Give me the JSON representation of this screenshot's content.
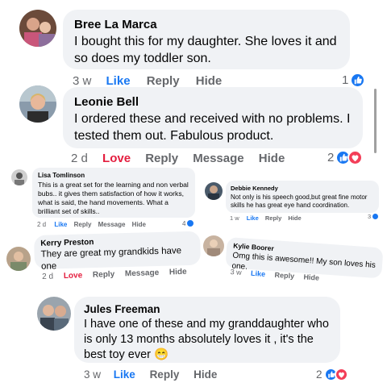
{
  "comments": [
    {
      "name": "Bree La Marca",
      "text": "I bought this for my daughter. She loves it and so does my toddler son.",
      "time": "3 w",
      "actions": {
        "react": "Like",
        "reply": "Reply",
        "hide": "Hide"
      },
      "reaction_count": "1",
      "reactions": [
        "like-icon"
      ]
    },
    {
      "name": "Leonie Bell",
      "text": "I ordered these and received with no problems. I tested them out. Fabulous product.",
      "time": "2 d",
      "actions": {
        "react": "Love",
        "reply": "Reply",
        "message": "Message",
        "hide": "Hide"
      },
      "reaction_count": "2",
      "reactions": [
        "like-icon",
        "love-icon"
      ]
    },
    {
      "name": "Lisa Tomlinson",
      "text": "This is a great set for the learning and non verbal  bubs.. it gives them satisfaction of how it works, what is said, the hand movements. What a brilliant set of skills..",
      "time": "2 d",
      "actions": {
        "react": "Like",
        "reply": "Reply",
        "message": "Message",
        "hide": "Hide"
      },
      "reaction_count": "4",
      "reactions": [
        "like-icon"
      ]
    },
    {
      "name": "Debbie Kennedy",
      "text": "Not only is his speech good,but great fine motor skills he has great eye hand coordination.",
      "time": "1 w",
      "actions": {
        "react": "Like",
        "reply": "Reply",
        "hide": "Hide"
      },
      "reaction_count": "3",
      "reactions": [
        "like-icon"
      ]
    },
    {
      "name": "Kerry Preston",
      "text": "They are great my grandkids have one",
      "time": "2 d",
      "actions": {
        "react": "Love",
        "reply": "Reply",
        "message": "Message",
        "hide": "Hide"
      }
    },
    {
      "name": "Kylie Boorer",
      "text": "Omg this is awesome!! My son loves his one.",
      "time": "3 w",
      "actions": {
        "react": "Like",
        "reply": "Reply",
        "hide": "Hide"
      }
    },
    {
      "name": "Jules Freeman",
      "text": "I have one of these and my granddaughter who is only 13 months absolutely loves it , it's the best toy ever 😁",
      "time": "3 w",
      "actions": {
        "react": "Like",
        "reply": "Reply",
        "hide": "Hide"
      },
      "reaction_count": "2",
      "reactions": [
        "like-icon",
        "love-icon"
      ]
    }
  ],
  "colors": {
    "like": "#1877f2",
    "love": "#e41e3f",
    "bubble": "#f0f2f5",
    "meta": "#65676b"
  }
}
